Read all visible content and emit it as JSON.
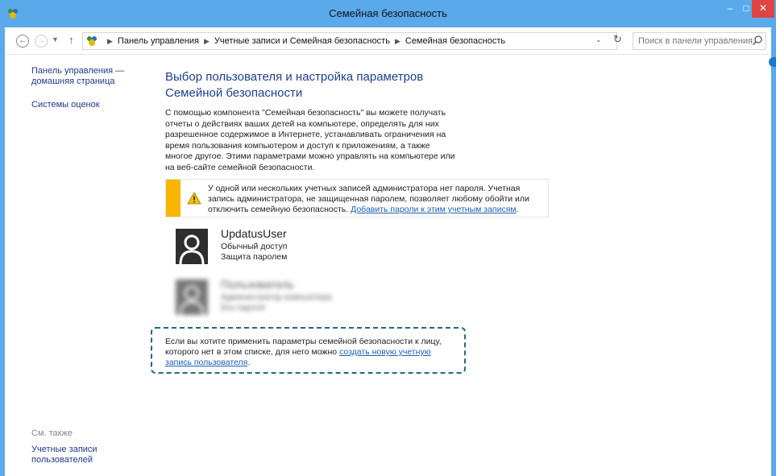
{
  "window": {
    "title": "Семейная безопасность",
    "minimize": "–",
    "maximize": "□",
    "close": "✕"
  },
  "address": {
    "crumbs": [
      "Панель управления",
      "Учетные записи и Семейная безопасность",
      "Семейная безопасность"
    ],
    "search_placeholder": "Поиск в панели управления"
  },
  "sidebar": {
    "home_link": "Панель управления — домашняя страница",
    "ratings_link": "Системы оценок",
    "see_also_label": "См. также",
    "see_also_link": "Учетные записи пользователей"
  },
  "main": {
    "heading": "Выбор пользователя и настройка параметров Семейной безопасности",
    "intro": "С помощью компонента \"Семейная безопасность\" вы можете получать отчеты о действиях ваших детей на компьютере, определять для них разрешенное содержимое в Интернете, устанавливать ограничения на время пользования компьютером и доступ к приложениям, а также многое другое. Этими параметрами можно управлять на компьютере или на веб-сайте семейной безопасности."
  },
  "warning": {
    "text": "У одной или нескольких учетных записей администратора нет пароля. Учетная запись администратора, не защищенная паролем, позволяет любому обойти или отключить семейную безопасность. ",
    "link": "Добавить пароли к этим учетным записям",
    "end": "."
  },
  "users": [
    {
      "name": "UpdatusUser",
      "line1": "Обычный доступ",
      "line2": "Защита паролем"
    },
    {
      "name": "Пользователь",
      "line1": "Администратор компьютера",
      "line2": "Без пароля"
    }
  ],
  "callout": {
    "text": "Если вы хотите применить параметры семейной безопасности к лицу, которого нет в этом списке, для него можно ",
    "link": "создать новую учетную запись пользователя",
    "end": "."
  },
  "colors": {
    "titlebar": "#5aa9ea",
    "warning_bar": "#f7b500",
    "link": "#1a5fb4",
    "callout_border": "#1f6a84"
  }
}
